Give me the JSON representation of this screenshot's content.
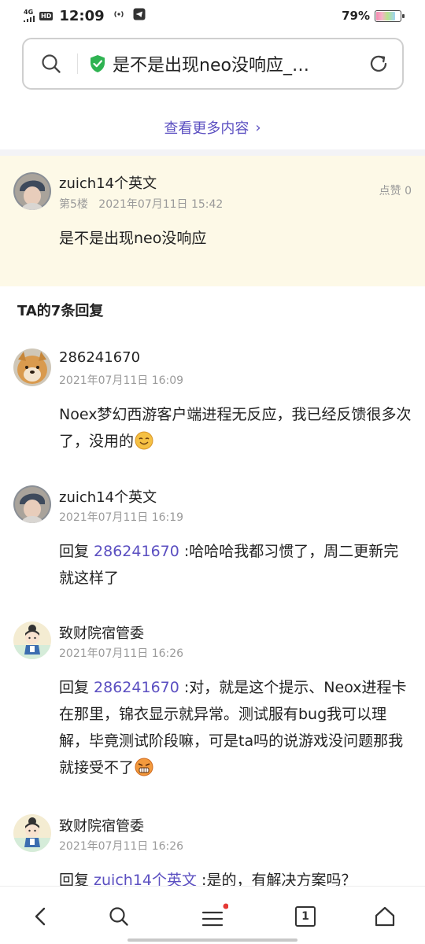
{
  "status_bar": {
    "network": "4G",
    "hd": "HD",
    "time": "12:09",
    "battery_percent": "79%",
    "battery_level": 0.79
  },
  "address_bar": {
    "page_title": "是不是出现neo没响应_…"
  },
  "more_link": {
    "label": "查看更多内容",
    "chevron": "›"
  },
  "main_post": {
    "username": "zuich14个英文",
    "floor": "第5楼",
    "timestamp": "2021年07月11日 15:42",
    "likes": "点赞 0",
    "content": "是不是出现neo没响应"
  },
  "replies_title": "TA的7条回复",
  "replies": [
    {
      "username": "286241670",
      "timestamp": "2021年07月11日 16:09",
      "content": "Noex梦幻西游客户端进程无反应，我已经反馈很多次了，没用的",
      "emoji": "smile-emoji"
    },
    {
      "username": "zuich14个英文",
      "timestamp": "2021年07月11日 16:19",
      "reply_prefix": "回复 ",
      "reply_to": "286241670",
      "content": " :哈哈哈我都习惯了，周二更新完就这样了"
    },
    {
      "username": "致财院宿管委",
      "timestamp": "2021年07月11日 16:26",
      "reply_prefix": "回复 ",
      "reply_to": "286241670",
      "content": " :对，就是这个提示、Neox进程卡在那里，锦衣显示就异常。测试服有bug我可以理解，毕竟测试阶段嘛，可是ta吗的说游戏没问题那我就接受不了",
      "emoji": "angry-emoji"
    },
    {
      "username": "致财院宿管委",
      "timestamp": "2021年07月11日 16:26",
      "reply_prefix": "回复 ",
      "reply_to": "zuich14个英文",
      "content": " :是的，有解决方案吗？"
    }
  ],
  "bottom_nav": {
    "back": "back-icon",
    "search": "search-icon",
    "menu": "menu-icon",
    "tabs_count": "1",
    "home": "home-icon"
  },
  "colors": {
    "accent": "#5b4fc1",
    "highlight_bg": "#fdf9e7",
    "meta_text": "#9a9a9a",
    "shield_green": "#2fb352",
    "notification_red": "#e53935"
  }
}
